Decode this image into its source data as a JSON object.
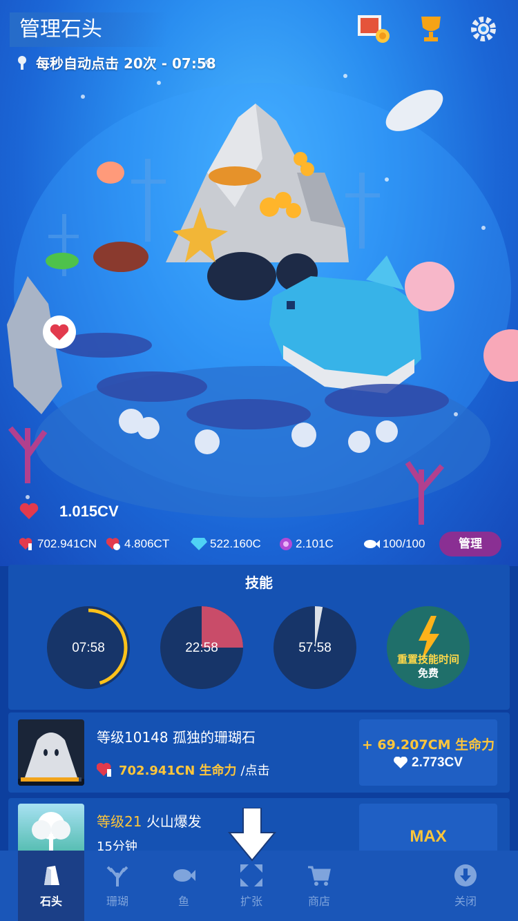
{
  "header": {
    "title": "管理石头",
    "auto_tap": "每秒自动点击 20次 - 07:58"
  },
  "resources": {
    "total_life": "1.015CV",
    "life_per_tap": "702.941CN",
    "timer_currency": "4.806CT",
    "gems": "522.160C",
    "pearls": "2.101C",
    "fish_capacity": "100/100",
    "manage_label": "管理"
  },
  "skills": {
    "title": "技能",
    "items": [
      {
        "time": "07:58",
        "progress": 0.45,
        "color": "#ffc21a"
      },
      {
        "time": "22:58",
        "progress": 0.25,
        "color": "#e9506a"
      },
      {
        "time": "57:58",
        "progress": 0.03,
        "color": "#ffffff"
      }
    ],
    "reset_label": "重置技能时间",
    "reset_cost": "免费"
  },
  "upgrades": [
    {
      "name": "等级10148 孤独的珊瑚石",
      "effect_value": "702.941CN 生命力",
      "effect_suffix": "/点击",
      "button_gain": "+ 69.207CM 生命力",
      "button_cost": "2.773CV",
      "progress": 0.95
    },
    {
      "name_level": "等级21",
      "name_title": "火山爆发",
      "sub": "15分钟",
      "button_label": "MAX"
    }
  ],
  "nav": {
    "items": [
      {
        "label": "石头",
        "icon": "rock-icon",
        "active": true
      },
      {
        "label": "珊瑚",
        "icon": "coral-icon",
        "active": false
      },
      {
        "label": "鱼",
        "icon": "fish-icon",
        "active": false
      },
      {
        "label": "扩张",
        "icon": "expand-icon",
        "active": false
      },
      {
        "label": "商店",
        "icon": "cart-icon",
        "active": false
      },
      {
        "label": "关闭",
        "icon": "close-down-icon",
        "active": false
      }
    ]
  },
  "colors": {
    "accent_gold": "#ffc63a",
    "manage_purple": "#8a2f93",
    "panel_blue": "#1552b3"
  }
}
